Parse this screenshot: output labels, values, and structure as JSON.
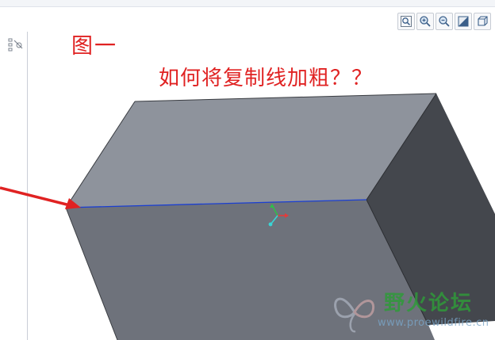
{
  "annotations": {
    "figure_label": "图一",
    "question": "如何将复制线加粗？？"
  },
  "toolbar": {
    "buttons": [
      {
        "name": "zoom-fit-icon"
      },
      {
        "name": "zoom-in-icon"
      },
      {
        "name": "zoom-out-icon"
      },
      {
        "name": "repaint-icon"
      },
      {
        "name": "view-box-icon"
      }
    ]
  },
  "watermark": {
    "title": "野火论坛",
    "url": "www.proewildfire.cn"
  },
  "colors": {
    "annotation_red": "#e02222",
    "top_face": "#8e939c",
    "front_face": "#6e727b",
    "side_face": "#44474d",
    "selected_edge": "#1b3fd1",
    "watermark_green": "#2f9a3a"
  }
}
